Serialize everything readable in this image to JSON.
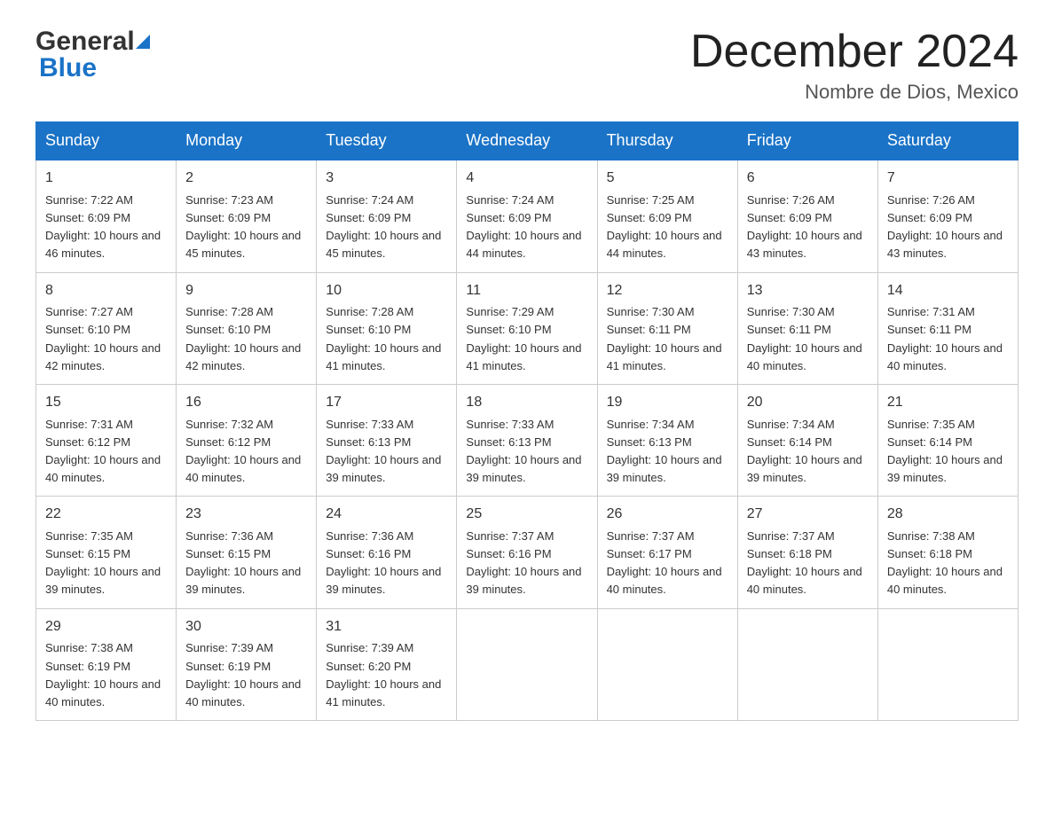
{
  "logo": {
    "text1": "General",
    "text2": "Blue"
  },
  "header": {
    "month": "December 2024",
    "location": "Nombre de Dios, Mexico"
  },
  "days_of_week": [
    "Sunday",
    "Monday",
    "Tuesday",
    "Wednesday",
    "Thursday",
    "Friday",
    "Saturday"
  ],
  "weeks": [
    [
      {
        "day": "1",
        "sunrise": "7:22 AM",
        "sunset": "6:09 PM",
        "daylight": "10 hours and 46 minutes."
      },
      {
        "day": "2",
        "sunrise": "7:23 AM",
        "sunset": "6:09 PM",
        "daylight": "10 hours and 45 minutes."
      },
      {
        "day": "3",
        "sunrise": "7:24 AM",
        "sunset": "6:09 PM",
        "daylight": "10 hours and 45 minutes."
      },
      {
        "day": "4",
        "sunrise": "7:24 AM",
        "sunset": "6:09 PM",
        "daylight": "10 hours and 44 minutes."
      },
      {
        "day": "5",
        "sunrise": "7:25 AM",
        "sunset": "6:09 PM",
        "daylight": "10 hours and 44 minutes."
      },
      {
        "day": "6",
        "sunrise": "7:26 AM",
        "sunset": "6:09 PM",
        "daylight": "10 hours and 43 minutes."
      },
      {
        "day": "7",
        "sunrise": "7:26 AM",
        "sunset": "6:09 PM",
        "daylight": "10 hours and 43 minutes."
      }
    ],
    [
      {
        "day": "8",
        "sunrise": "7:27 AM",
        "sunset": "6:10 PM",
        "daylight": "10 hours and 42 minutes."
      },
      {
        "day": "9",
        "sunrise": "7:28 AM",
        "sunset": "6:10 PM",
        "daylight": "10 hours and 42 minutes."
      },
      {
        "day": "10",
        "sunrise": "7:28 AM",
        "sunset": "6:10 PM",
        "daylight": "10 hours and 41 minutes."
      },
      {
        "day": "11",
        "sunrise": "7:29 AM",
        "sunset": "6:10 PM",
        "daylight": "10 hours and 41 minutes."
      },
      {
        "day": "12",
        "sunrise": "7:30 AM",
        "sunset": "6:11 PM",
        "daylight": "10 hours and 41 minutes."
      },
      {
        "day": "13",
        "sunrise": "7:30 AM",
        "sunset": "6:11 PM",
        "daylight": "10 hours and 40 minutes."
      },
      {
        "day": "14",
        "sunrise": "7:31 AM",
        "sunset": "6:11 PM",
        "daylight": "10 hours and 40 minutes."
      }
    ],
    [
      {
        "day": "15",
        "sunrise": "7:31 AM",
        "sunset": "6:12 PM",
        "daylight": "10 hours and 40 minutes."
      },
      {
        "day": "16",
        "sunrise": "7:32 AM",
        "sunset": "6:12 PM",
        "daylight": "10 hours and 40 minutes."
      },
      {
        "day": "17",
        "sunrise": "7:33 AM",
        "sunset": "6:13 PM",
        "daylight": "10 hours and 39 minutes."
      },
      {
        "day": "18",
        "sunrise": "7:33 AM",
        "sunset": "6:13 PM",
        "daylight": "10 hours and 39 minutes."
      },
      {
        "day": "19",
        "sunrise": "7:34 AM",
        "sunset": "6:13 PM",
        "daylight": "10 hours and 39 minutes."
      },
      {
        "day": "20",
        "sunrise": "7:34 AM",
        "sunset": "6:14 PM",
        "daylight": "10 hours and 39 minutes."
      },
      {
        "day": "21",
        "sunrise": "7:35 AM",
        "sunset": "6:14 PM",
        "daylight": "10 hours and 39 minutes."
      }
    ],
    [
      {
        "day": "22",
        "sunrise": "7:35 AM",
        "sunset": "6:15 PM",
        "daylight": "10 hours and 39 minutes."
      },
      {
        "day": "23",
        "sunrise": "7:36 AM",
        "sunset": "6:15 PM",
        "daylight": "10 hours and 39 minutes."
      },
      {
        "day": "24",
        "sunrise": "7:36 AM",
        "sunset": "6:16 PM",
        "daylight": "10 hours and 39 minutes."
      },
      {
        "day": "25",
        "sunrise": "7:37 AM",
        "sunset": "6:16 PM",
        "daylight": "10 hours and 39 minutes."
      },
      {
        "day": "26",
        "sunrise": "7:37 AM",
        "sunset": "6:17 PM",
        "daylight": "10 hours and 40 minutes."
      },
      {
        "day": "27",
        "sunrise": "7:37 AM",
        "sunset": "6:18 PM",
        "daylight": "10 hours and 40 minutes."
      },
      {
        "day": "28",
        "sunrise": "7:38 AM",
        "sunset": "6:18 PM",
        "daylight": "10 hours and 40 minutes."
      }
    ],
    [
      {
        "day": "29",
        "sunrise": "7:38 AM",
        "sunset": "6:19 PM",
        "daylight": "10 hours and 40 minutes."
      },
      {
        "day": "30",
        "sunrise": "7:39 AM",
        "sunset": "6:19 PM",
        "daylight": "10 hours and 40 minutes."
      },
      {
        "day": "31",
        "sunrise": "7:39 AM",
        "sunset": "6:20 PM",
        "daylight": "10 hours and 41 minutes."
      },
      null,
      null,
      null,
      null
    ]
  ]
}
